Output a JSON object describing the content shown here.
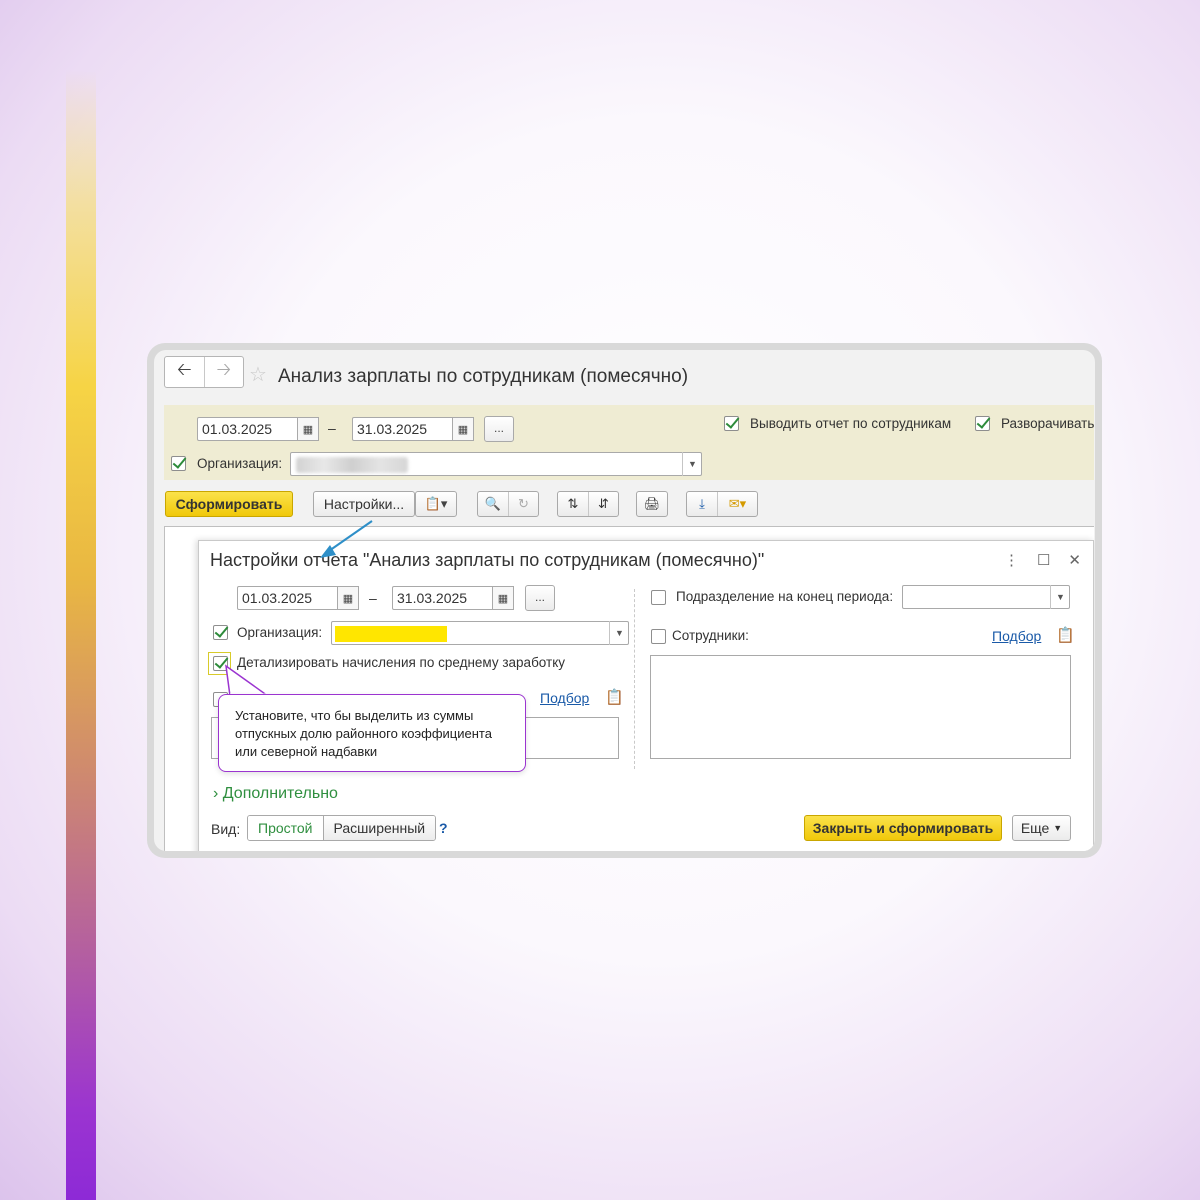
{
  "window": {
    "title": "Анализ зарплаты по сотрудникам (помесячно)"
  },
  "params": {
    "date_from": "01.03.2025",
    "date_to": "31.03.2025",
    "dash": "–",
    "period_button": "...",
    "org_label": "Организация:",
    "org_checked": true,
    "by_employees_label": "Выводить отчет по сотрудникам",
    "by_employees_checked": true,
    "expand_label": "Разворачивать",
    "expand_checked": true
  },
  "toolbar": {
    "generate": "Сформировать",
    "settings": "Настройки...",
    "icons": [
      "variants-icon",
      "search-icon",
      "find-next-icon",
      "sort-asc-icon",
      "sort-desc-icon",
      "print-icon",
      "save-icon",
      "email-icon"
    ]
  },
  "dialog": {
    "title": "Настройки отчета \"Анализ зарплаты по сотрудникам (помесячно)\"",
    "date_from": "01.03.2025",
    "date_to": "31.03.2025",
    "dash": "–",
    "period_button": "...",
    "org_label": "Организация:",
    "org_checked": true,
    "detail_label": "Детализировать начисления по среднему заработку",
    "detail_checked": true,
    "podbor_left": "Подбор",
    "department_label": "Подразделение на конец периода:",
    "department_checked": false,
    "employees_label": "Сотрудники:",
    "employees_checked": false,
    "podbor_right": "Подбор",
    "more_section": "Дополнительно",
    "view_label": "Вид:",
    "view_options": [
      "Простой",
      "Расширенный"
    ],
    "view_selected": "Простой",
    "help": "?",
    "close_generate": "Закрыть и сформировать",
    "more_button": "Еще"
  },
  "callout": {
    "text": "Установите, что бы выделить из суммы отпускных долю районного коэффициента или северной надбавки"
  },
  "colors": {
    "accent_yellow": "#f0c80a",
    "green_check": "#2d8b3a",
    "link_blue": "#1a5aa8",
    "callout_border": "#9b34d0",
    "arrow": "#2e8fc8"
  }
}
